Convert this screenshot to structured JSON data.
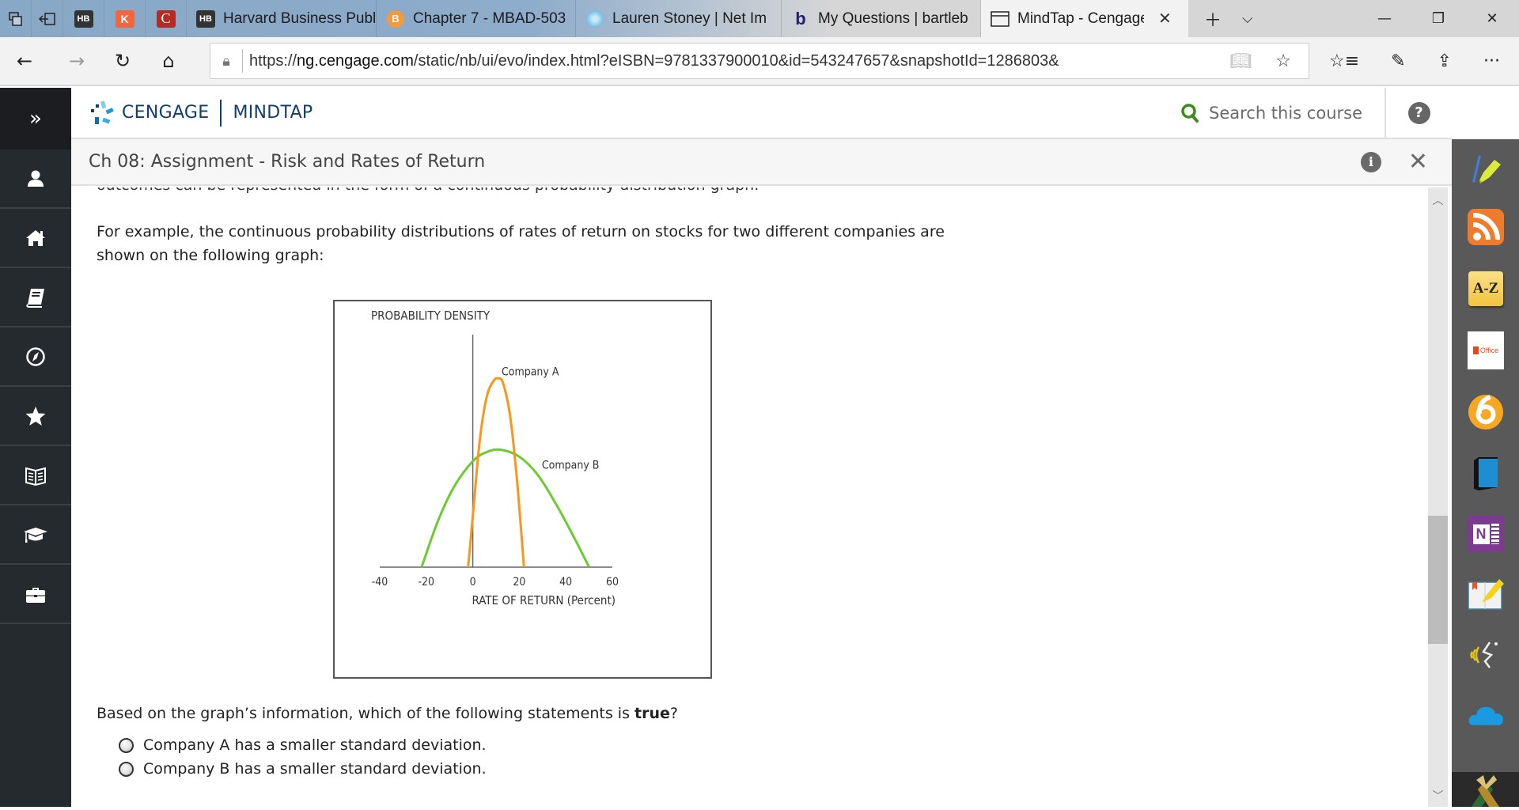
{
  "browser": {
    "tabs": [
      {
        "label": "Harvard Business Publi",
        "icon": "hb-icon"
      },
      {
        "label": "Chapter 7 - MBAD-503",
        "icon": "bb-icon"
      },
      {
        "label": "Lauren Stoney | Net Im",
        "icon": "globe-icon"
      },
      {
        "label": "My Questions | bartleb",
        "icon": "bartleby-icon"
      },
      {
        "label": "MindTap - Cengage",
        "icon": "window-icon",
        "active": true
      }
    ],
    "pinned": [
      {
        "name": "hb-pinned",
        "label": "HB",
        "color": "#333333"
      },
      {
        "name": "k-pinned",
        "label": "K",
        "color": "#f2663f"
      },
      {
        "name": "c-pinned",
        "label": "C",
        "color": "#b52a25"
      }
    ],
    "hb_label": "HB",
    "bb_letter": "B",
    "bartleby_letter": "b",
    "url_prefix": "https://",
    "url_host": "ng.cengage.com",
    "url_path": "/static/nb/ui/evo/index.html?eISBN=9781337900010&id=543247657&snapshotId=1286803&"
  },
  "app": {
    "brand_left": "CENGAGE",
    "brand_right": "MINDTAP",
    "search_placeholder": "Search this course",
    "help_label": "?",
    "info_label": "i",
    "close_label": "✕",
    "toggle_label": "»",
    "page_title": "Ch 08: Assignment - Risk and Rates of Return",
    "sidebar": [
      "user",
      "home",
      "notebook",
      "compass",
      "star",
      "reader",
      "graduation-cap",
      "briefcase"
    ],
    "tools": [
      "highlighter-pen",
      "rss",
      "a-z-glossary",
      "office",
      "flashcard-6",
      "ebook",
      "onenote",
      "notes-highlight",
      "readspeaker",
      "onedrive"
    ],
    "office_label": "Office",
    "az_label": "A-Z",
    "onenote_label": "N"
  },
  "content": {
    "cut_line": "outcomes can be represented in the form of a continuous probability distribution graph.",
    "intro": "For example, the continuous probability distributions of rates of return on stocks for two different companies are shown on the following graph:",
    "question_pre": "Based on the graph’s information, which of the following statements is ",
    "question_bold": "true",
    "question_post": "?",
    "options": [
      "Company A has a smaller standard deviation.",
      "Company B has a smaller standard deviation."
    ]
  },
  "chart_data": {
    "type": "line",
    "title": "",
    "ylabel": "PROBABILITY DENSITY",
    "xlabel": "RATE OF RETURN (Percent)",
    "xlim": [
      -40,
      60
    ],
    "ylim": [
      0,
      1
    ],
    "xticks": [
      -40,
      -20,
      0,
      20,
      40,
      60
    ],
    "grid": false,
    "series": [
      {
        "name": "Company A",
        "color": "#f7971c",
        "mean": 11,
        "low": -2,
        "high": 22,
        "peak_density": 0.82,
        "points": [
          [
            -2,
            0
          ],
          [
            0,
            0.22
          ],
          [
            3,
            0.55
          ],
          [
            6,
            0.74
          ],
          [
            9,
            0.81
          ],
          [
            11,
            0.82
          ],
          [
            13,
            0.8
          ],
          [
            16,
            0.66
          ],
          [
            19,
            0.38
          ],
          [
            22,
            0
          ]
        ]
      },
      {
        "name": "Company B",
        "color": "#6ccb2f",
        "mean": 12,
        "low": -22,
        "high": 50,
        "peak_density": 0.51,
        "points": [
          [
            -22,
            0
          ],
          [
            -15,
            0.2
          ],
          [
            -8,
            0.35
          ],
          [
            0,
            0.46
          ],
          [
            6,
            0.5
          ],
          [
            12,
            0.51
          ],
          [
            20,
            0.48
          ],
          [
            28,
            0.4
          ],
          [
            36,
            0.27
          ],
          [
            44,
            0.12
          ],
          [
            50,
            0
          ]
        ]
      }
    ],
    "legend": "inline labels"
  }
}
